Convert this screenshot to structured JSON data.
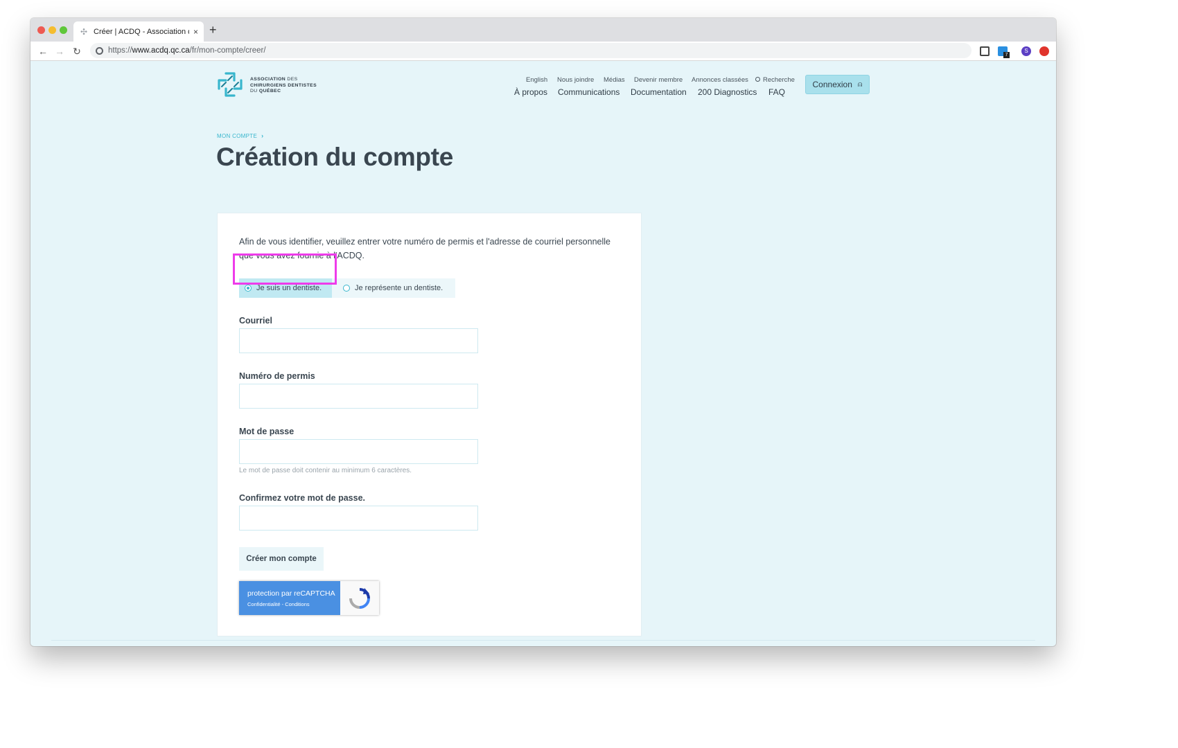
{
  "browser": {
    "tab_title": "Créer | ACDQ - Association de",
    "tab_close": "×",
    "new_tab": "+",
    "url_prefix": "https://",
    "url_host": "www.acdq.qc.ca",
    "url_path": "/fr/mon-compte/creer/",
    "ext_badge": "7",
    "profile_initial": "S"
  },
  "header": {
    "logo": {
      "line1_bold": "ASSOCIATION",
      "line1_rest": " DES",
      "line2": "CHIRURGIENS DENTISTES",
      "line3_rest": "DU ",
      "line3_bold": "QUÉBEC"
    },
    "subnav": [
      "English",
      "Nous joindre",
      "Médias",
      "Devenir membre",
      "Annonces classées",
      "Recherche"
    ],
    "mainnav": [
      "À propos",
      "Communications",
      "Documentation",
      "200 Diagnostics",
      "FAQ"
    ],
    "login_label": "Connexion"
  },
  "breadcrumb": {
    "label": "MON COMPTE",
    "chevron": "›"
  },
  "title": "Création du compte",
  "form": {
    "intro": "Afin de vous identifier, veuillez entrer votre numéro de permis et l'adresse de courriel personnelle que vous avez fournie à l'ACDQ.",
    "radio_selected": "Je suis un dentiste.",
    "radio_other": "Je représente un dentiste.",
    "email_label": "Courriel",
    "permit_label": "Numéro de permis",
    "password_label": "Mot de passe",
    "password_hint": "Le mot de passe doit contenir au minimum 6 caractères.",
    "confirm_label": "Confirmez votre mot de passe.",
    "submit_label": "Créer mon compte"
  },
  "recaptcha": {
    "title": "protection par reCAPTCHA",
    "links": "Confidentialité - Conditions"
  },
  "colors": {
    "page_bg": "#e6f5f9",
    "accent": "#38b6cd",
    "login_bg": "#a9e0ec",
    "highlight": "#ee3bea",
    "recaptcha": "#4a90e2"
  }
}
